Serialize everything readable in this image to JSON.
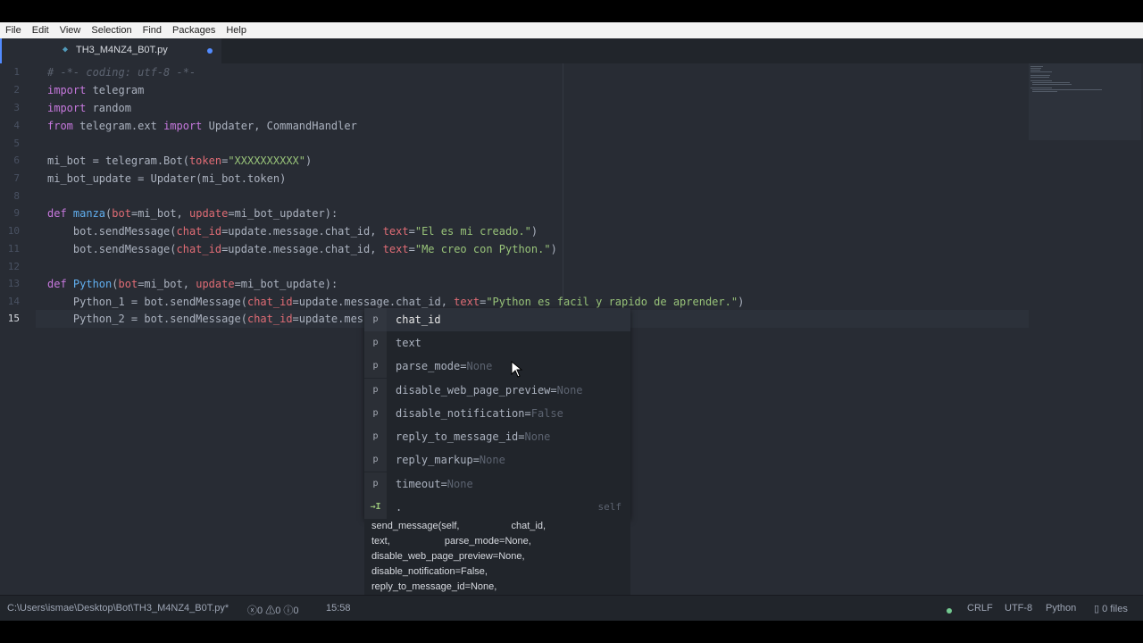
{
  "menu": [
    "File",
    "Edit",
    "View",
    "Selection",
    "Find",
    "Packages",
    "Help"
  ],
  "tab": {
    "icon": "python-file-icon",
    "label": "TH3_M4NZ4_B0T.py",
    "modified": true
  },
  "line_numbers": [
    "1",
    "2",
    "3",
    "4",
    "5",
    "6",
    "7",
    "8",
    "9",
    "10",
    "11",
    "12",
    "13",
    "14",
    "15"
  ],
  "code": {
    "l1": "# -*- coding: utf-8 -*-",
    "l2_kw": "import",
    "l2_rest": " telegram",
    "l3_kw": "import",
    "l3_rest": " random",
    "l4_kw1": "from",
    "l4_mid": " telegram.ext ",
    "l4_kw2": "import",
    "l4_rest": " Updater, CommandHandler",
    "l6_a": "mi_bot = telegram.Bot(",
    "l6_p": "token",
    "l6_eq": "=",
    "l6_s": "\"XXXXXXXXXX\"",
    "l6_e": ")",
    "l7": "mi_bot_update = Updater(mi_bot.token)",
    "l9_kw": "def",
    "l9_fn": " manza",
    "l9_a": "(",
    "l9_p1": "bot",
    "l9_b": "=mi_bot, ",
    "l9_p2": "update",
    "l9_c": "=mi_bot_updater):",
    "l10_a": "    bot.sendMessage(",
    "l10_p1": "chat_id",
    "l10_b": "=update.message.chat_id, ",
    "l10_p2": "text",
    "l10_eq": "=",
    "l10_s": "\"El es mi creado.\"",
    "l10_e": ")",
    "l11_a": "    bot.sendMessage(",
    "l11_p1": "chat_id",
    "l11_b": "=update.message.chat_id, ",
    "l11_p2": "text",
    "l11_eq": "=",
    "l11_s": "\"Me creo con Python.\"",
    "l11_e": ")",
    "l13_kw": "def",
    "l13_fn": " Python",
    "l13_a": "(",
    "l13_p1": "bot",
    "l13_b": "=mi_bot, ",
    "l13_p2": "update",
    "l13_c": "=mi_bot_update):",
    "l14_a": "    Python_1 = bot.sendMessage(",
    "l14_p1": "chat_id",
    "l14_b": "=update.message.chat_id, ",
    "l14_p2": "text",
    "l14_eq": "=",
    "l14_s": "\"Python es facil y rapido de aprender.\"",
    "l14_e": ")",
    "l15_a": "    Python_2 = bot.sendMessage(",
    "l15_p1": "chat_id",
    "l15_b": "=update.message.cha",
    "l15_e": ")"
  },
  "autocomplete": {
    "items": [
      {
        "type": "p",
        "name": "chat_id",
        "default": ""
      },
      {
        "type": "p",
        "name": "text",
        "default": ""
      },
      {
        "type": "p",
        "name": "parse_mode=",
        "default": "None"
      },
      {
        "type": "p",
        "name": "disable_web_page_preview=",
        "default": "None"
      },
      {
        "type": "p",
        "name": "disable_notification=",
        "default": "False"
      },
      {
        "type": "p",
        "name": "reply_to_message_id=",
        "default": "None"
      },
      {
        "type": "p",
        "name": "reply_markup=",
        "default": "None"
      },
      {
        "type": "p",
        "name": "timeout=",
        "default": "None"
      }
    ],
    "snippet": {
      "type": "→I",
      "name": ".",
      "right": "self"
    },
    "doc": [
      "send_message(self,                   chat_id,",
      "text,                    parse_mode=None,",
      "disable_web_page_preview=None,",
      "disable_notification=False,",
      "reply_to_message_id=None,"
    ]
  },
  "status": {
    "path": "C:\\Users\\ismae\\Desktop\\Bot\\TH3_M4NZ4_B0T.py*",
    "errors": "0",
    "warnings": "0",
    "infos": "0",
    "cursor_pos": "15:58",
    "line_ending": "CRLF",
    "encoding": "UTF-8",
    "grammar": "Python",
    "files": "0 files"
  },
  "colors": {
    "accent": "#528bff",
    "keyword": "#c678dd",
    "string": "#98c379",
    "function": "#61afef",
    "param": "#e06c75"
  }
}
